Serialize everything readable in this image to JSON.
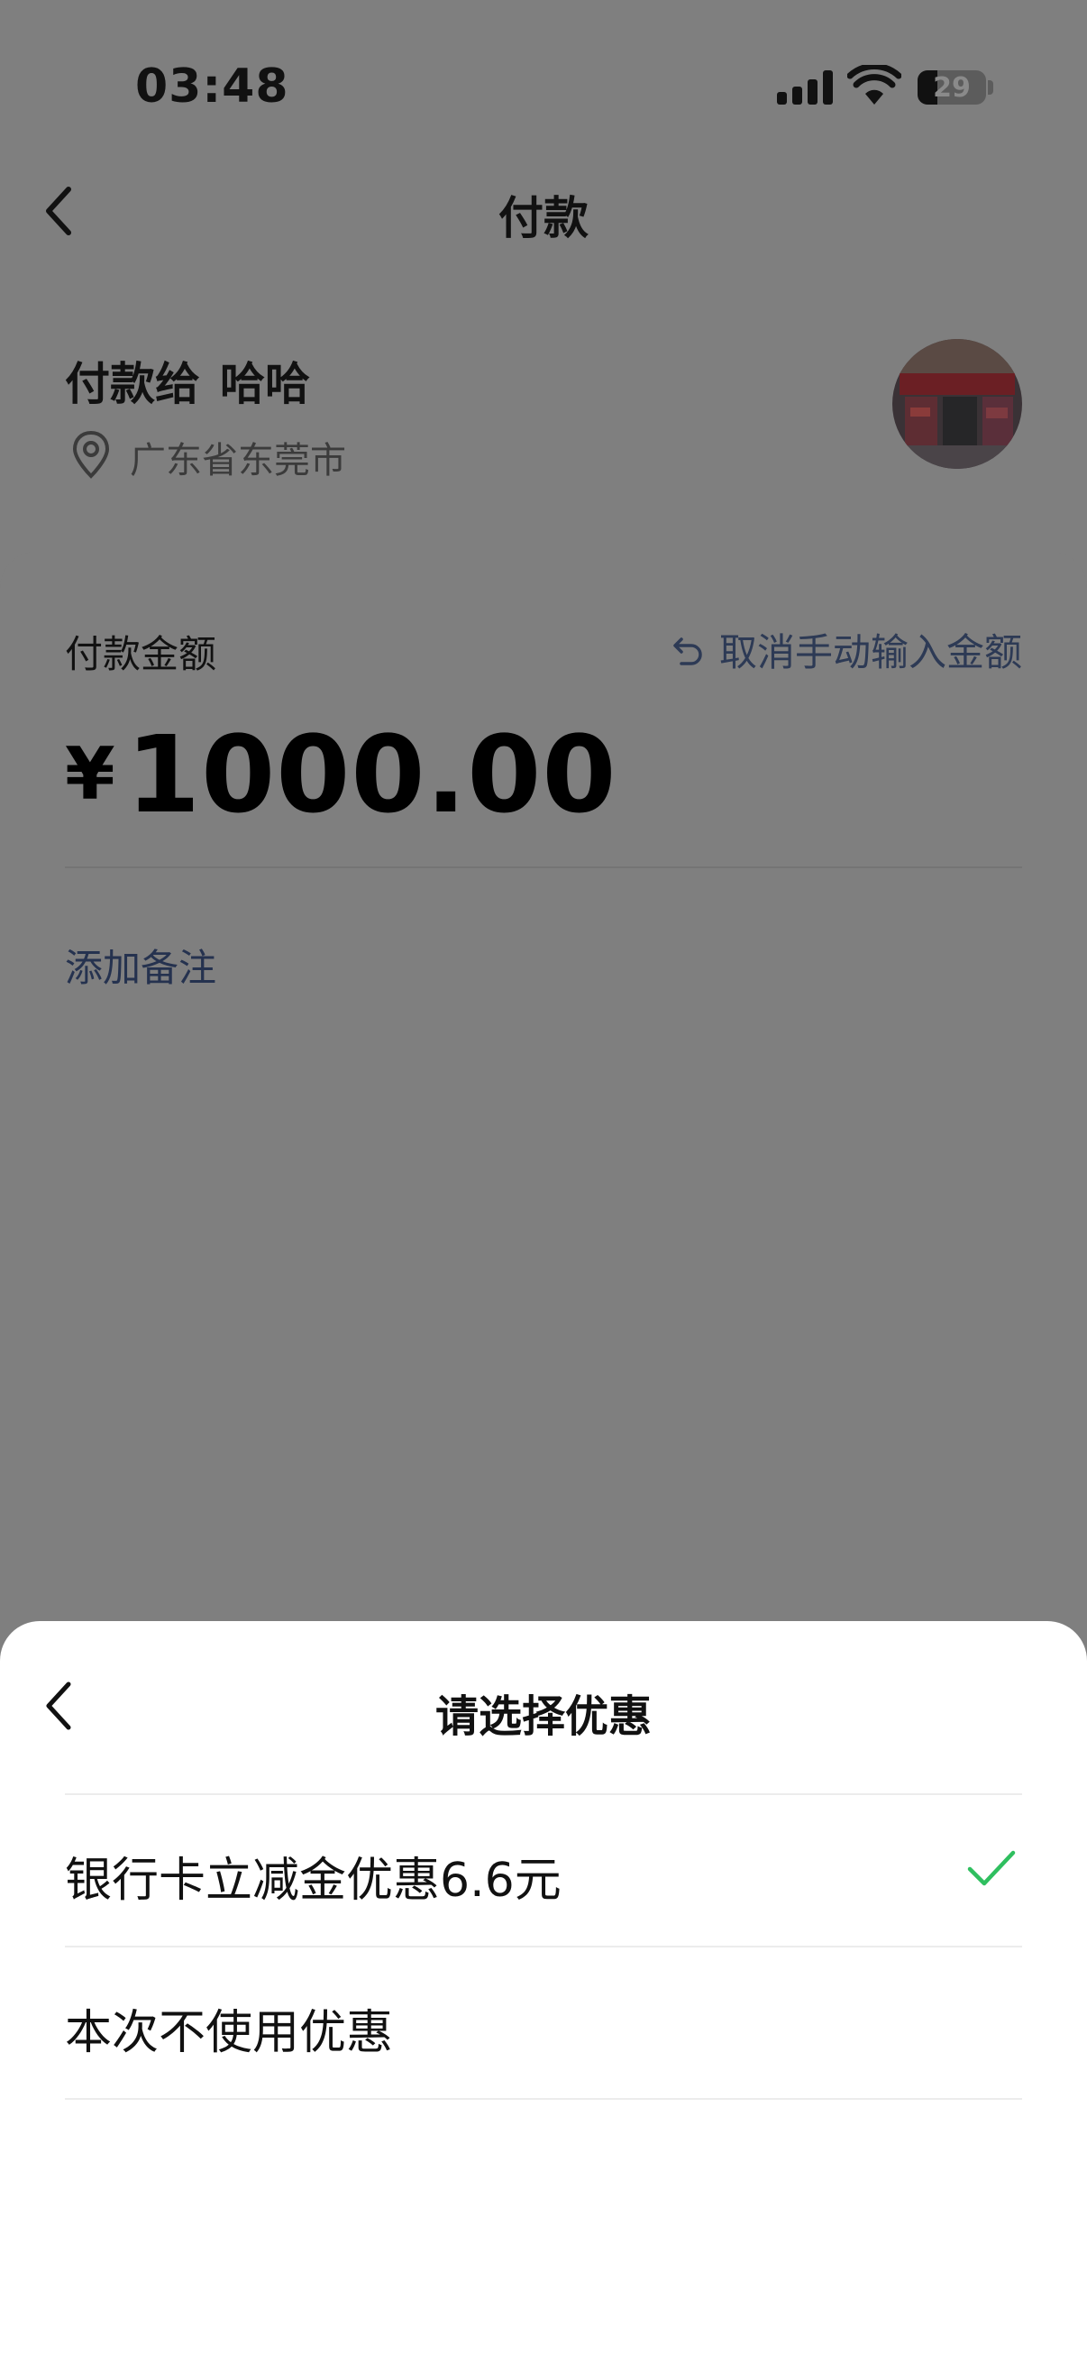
{
  "status_bar": {
    "time": "03:48",
    "battery": "29",
    "battery_level": 0.29
  },
  "nav": {
    "title": "付款",
    "back_icon": "chevron-left-icon"
  },
  "payee": {
    "prefix": "付款给",
    "name": "哈哈",
    "location": "广东省东莞市",
    "location_icon": "map-pin-icon"
  },
  "payment": {
    "amount_label": "付款金额",
    "cancel_manual": "取消手动输入金额",
    "cancel_icon": "undo-icon",
    "currency": "¥",
    "amount": "1000.00",
    "add_remark": "添加备注"
  },
  "discount_sheet": {
    "title": "请选择优惠",
    "back_icon": "chevron-left-icon",
    "options": [
      {
        "label": "银行卡立减金优惠6.6元",
        "selected": true
      },
      {
        "label": "本次不使用优惠",
        "selected": false
      }
    ]
  },
  "colors": {
    "accent_green": "#2fbf5f",
    "link_blue": "#2d3a55",
    "sheet_bg": "#ffffff",
    "overlay_bg": "#7f7f7f"
  }
}
